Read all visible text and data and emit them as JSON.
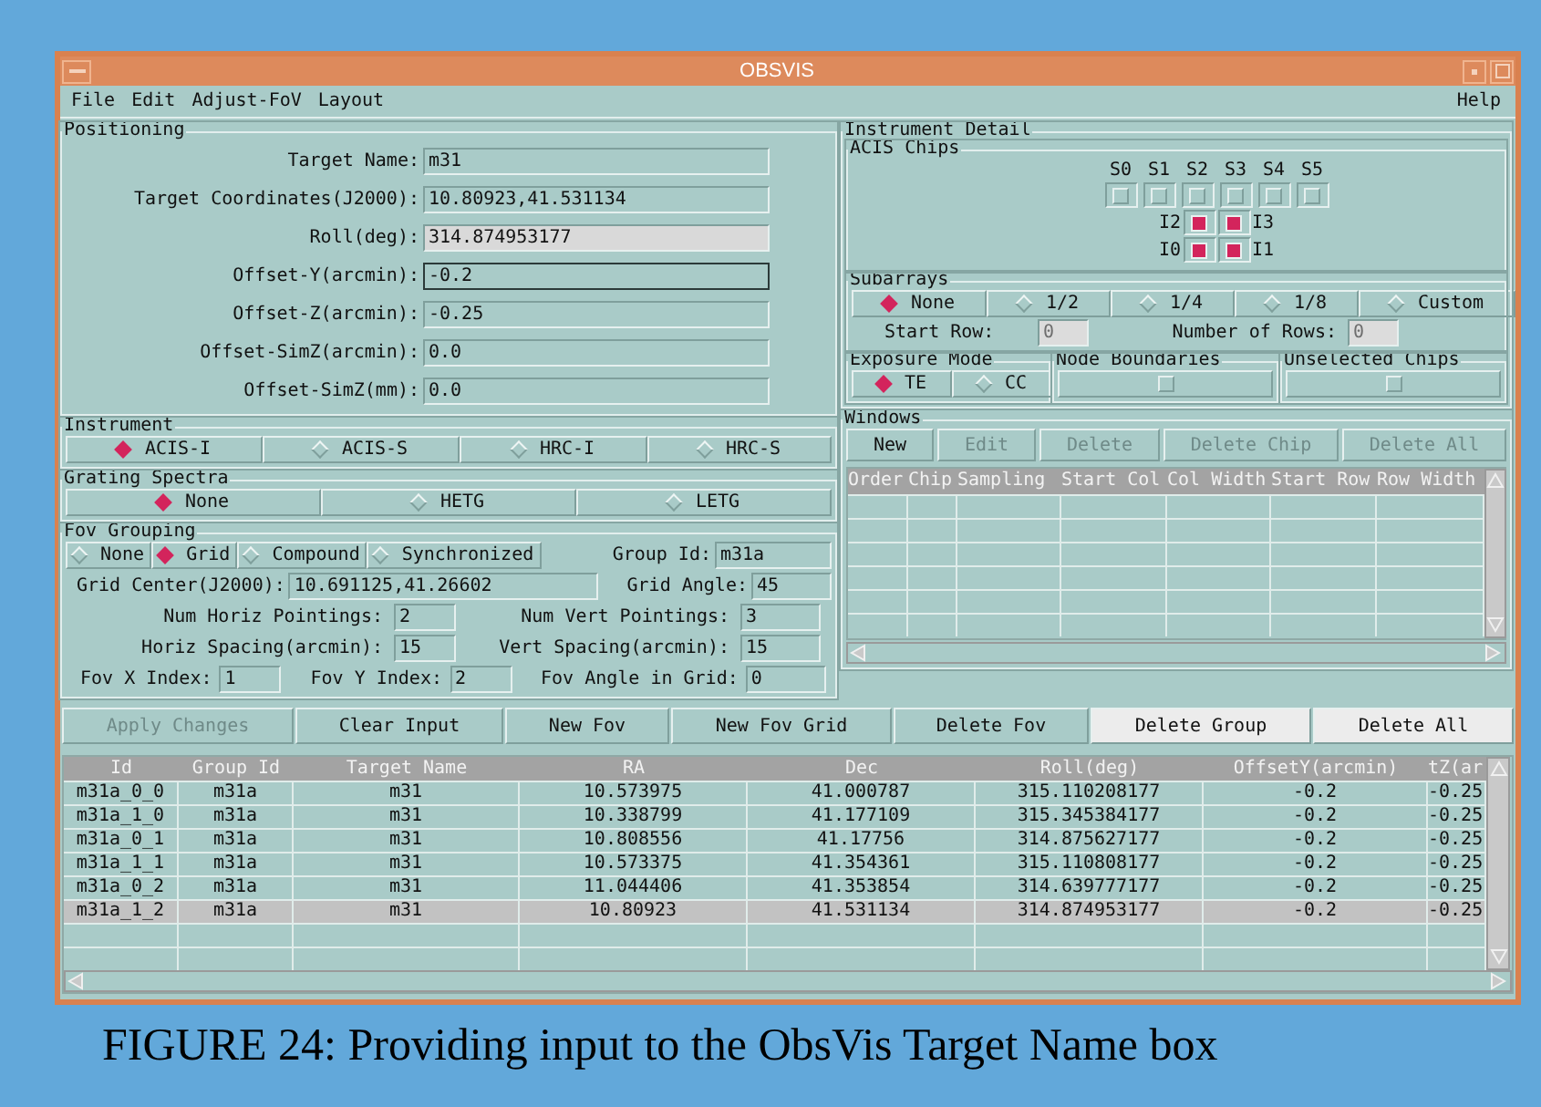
{
  "window": {
    "title": "OBSVIS"
  },
  "menu": [
    {
      "label": "File"
    },
    {
      "label": "Edit"
    },
    {
      "label": "Adjust-FoV"
    },
    {
      "label": "Layout"
    }
  ],
  "help": {
    "label": "Help"
  },
  "positioning": {
    "title": "Positioning",
    "fields": [
      {
        "label": "Target Name:",
        "value": "m31",
        "kind": "text",
        "focused": false
      },
      {
        "label": "Target Coordinates(J2000):",
        "value": "10.80923,41.531134",
        "kind": "text",
        "focused": false
      },
      {
        "label": "Roll(deg):",
        "value": "314.874953177",
        "kind": "readonly",
        "focused": false
      },
      {
        "label": "Offset-Y(arcmin):",
        "value": "-0.2",
        "kind": "text",
        "focused": true
      },
      {
        "label": "Offset-Z(arcmin):",
        "value": "-0.25",
        "kind": "text",
        "focused": false
      },
      {
        "label": "Offset-SimZ(arcmin):",
        "value": "0.0",
        "kind": "text",
        "focused": false
      },
      {
        "label": "Offset-SimZ(mm):",
        "value": "0.0",
        "kind": "text",
        "focused": false
      }
    ]
  },
  "instrument": {
    "title": "Instrument",
    "options": [
      {
        "label": "ACIS-I",
        "selected": true
      },
      {
        "label": "ACIS-S",
        "selected": false
      },
      {
        "label": "HRC-I",
        "selected": false
      },
      {
        "label": "HRC-S",
        "selected": false
      }
    ]
  },
  "grating": {
    "title": "Grating Spectra",
    "options": [
      {
        "label": "None",
        "selected": true
      },
      {
        "label": "HETG",
        "selected": false
      },
      {
        "label": "LETG",
        "selected": false
      }
    ]
  },
  "fov_grouping": {
    "title": "Fov  Grouping",
    "modes": [
      {
        "label": "None",
        "selected": false
      },
      {
        "label": "Grid",
        "selected": true
      },
      {
        "label": "Compound",
        "selected": false
      },
      {
        "label": "Synchronized",
        "selected": false
      }
    ],
    "group_id": {
      "label": "Group Id:",
      "value": "m31a"
    },
    "grid_center": {
      "label": "Grid Center(J2000):",
      "value": "10.691125,41.26602"
    },
    "grid_angle": {
      "label": "Grid Angle:",
      "value": "45"
    },
    "pointings": [
      {
        "label": "Num Horiz Pointings:",
        "value": "2"
      },
      {
        "label": "Num Vert Pointings:",
        "value": "3"
      },
      {
        "label": "Horiz Spacing(arcmin):",
        "value": "15"
      },
      {
        "label": "Vert Spacing(arcmin):",
        "value": "15"
      }
    ],
    "indices": [
      {
        "label": "Fov X Index:",
        "value": "1"
      },
      {
        "label": "Fov Y Index:",
        "value": "2"
      },
      {
        "label": "Fov Angle in Grid:",
        "value": "0"
      }
    ]
  },
  "instrument_detail": {
    "title": "Instrument Detail",
    "acis_chips": {
      "title": "ACIS Chips",
      "s_chips": [
        {
          "label": "S0",
          "checked": false
        },
        {
          "label": "S1",
          "checked": false
        },
        {
          "label": "S2",
          "checked": false
        },
        {
          "label": "S3",
          "checked": false
        },
        {
          "label": "S4",
          "checked": false
        },
        {
          "label": "S5",
          "checked": false
        }
      ],
      "i_chips": [
        {
          "label": "I2",
          "checked": true
        },
        {
          "label": "I3",
          "checked": true
        },
        {
          "label": "I0",
          "checked": true
        },
        {
          "label": "I1",
          "checked": true
        }
      ]
    },
    "subarrays": {
      "title": "Subarrays",
      "options": [
        {
          "label": "None",
          "selected": true
        },
        {
          "label": "1/2",
          "selected": false
        },
        {
          "label": "1/4",
          "selected": false
        },
        {
          "label": "1/8",
          "selected": false
        },
        {
          "label": "Custom",
          "selected": false
        }
      ],
      "start_row": {
        "label": "Start Row:",
        "value": "0",
        "disabled": true
      },
      "num_rows": {
        "label": "Number of Rows:",
        "value": "0",
        "disabled": true
      }
    },
    "exposure_mode": {
      "title": "Exposure Mode",
      "options": [
        {
          "label": "TE",
          "selected": true
        },
        {
          "label": "CC",
          "selected": false
        }
      ]
    },
    "node_boundaries": {
      "title": "Node Boundaries",
      "checked": false
    },
    "unselected_chips": {
      "title": "Unselected Chips",
      "checked": false
    }
  },
  "windows": {
    "title": "Windows",
    "buttons": [
      {
        "label": "New",
        "disabled": false
      },
      {
        "label": "Edit",
        "disabled": true
      },
      {
        "label": "Delete",
        "disabled": true
      },
      {
        "label": "Delete Chip",
        "disabled": true
      },
      {
        "label": "Delete All",
        "disabled": true
      }
    ],
    "columns": [
      "Order",
      "Chip",
      "Sampling",
      "Start Col",
      "Col Width",
      "Start Row",
      "Row Width"
    ]
  },
  "actions": [
    {
      "label": "Apply Changes",
      "disabled": true,
      "kind": "normal"
    },
    {
      "label": "Clear Input",
      "disabled": false,
      "kind": "normal"
    },
    {
      "label": "New Fov",
      "disabled": false,
      "kind": "normal"
    },
    {
      "label": "New Fov Grid",
      "disabled": false,
      "kind": "normal"
    },
    {
      "label": "Delete Fov",
      "disabled": false,
      "kind": "normal"
    },
    {
      "label": "Delete Group",
      "disabled": false,
      "kind": "light"
    },
    {
      "label": "Delete All",
      "disabled": false,
      "kind": "light"
    }
  ],
  "table": {
    "columns": [
      "Id",
      "Group Id",
      "Target Name",
      "RA",
      "Dec",
      "Roll(deg)",
      "OffsetY(arcmin)",
      "tZ(ar"
    ],
    "rows": [
      {
        "cells": [
          "m31a_0_0",
          "m31a",
          "m31",
          "10.573975",
          "41.000787",
          "315.110208177",
          "-0.2",
          "-0.25"
        ],
        "selected": false
      },
      {
        "cells": [
          "m31a_1_0",
          "m31a",
          "m31",
          "10.338799",
          "41.177109",
          "315.345384177",
          "-0.2",
          "-0.25"
        ],
        "selected": false
      },
      {
        "cells": [
          "m31a_0_1",
          "m31a",
          "m31",
          "10.808556",
          "41.17756",
          "314.875627177",
          "-0.2",
          "-0.25"
        ],
        "selected": false
      },
      {
        "cells": [
          "m31a_1_1",
          "m31a",
          "m31",
          "10.573375",
          "41.354361",
          "315.110808177",
          "-0.2",
          "-0.25"
        ],
        "selected": false
      },
      {
        "cells": [
          "m31a_0_2",
          "m31a",
          "m31",
          "11.044406",
          "41.353854",
          "314.639777177",
          "-0.2",
          "-0.25"
        ],
        "selected": false
      },
      {
        "cells": [
          "m31a_1_2",
          "m31a",
          "m31",
          "10.80923",
          "41.531134",
          "314.874953177",
          "-0.2",
          "-0.25"
        ],
        "selected": true
      }
    ]
  },
  "caption": "FIGURE 24: Providing input to the ObsVis Target Name box"
}
